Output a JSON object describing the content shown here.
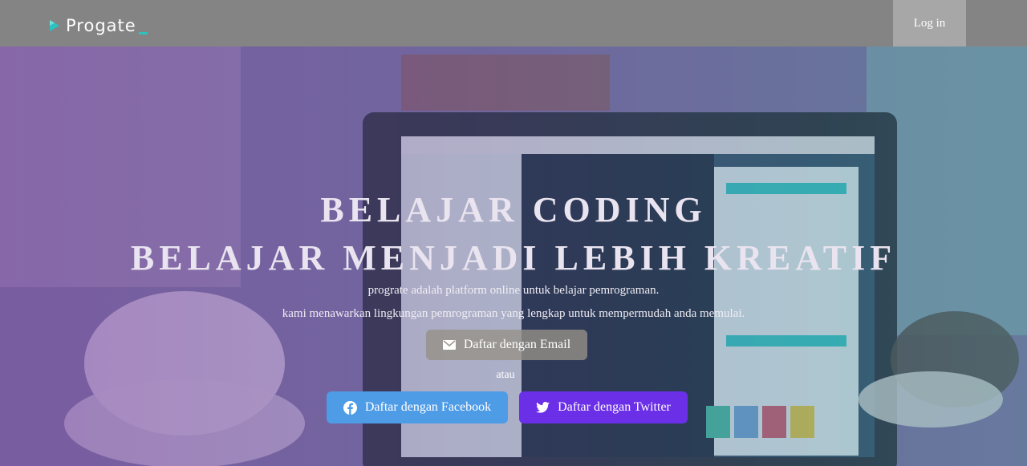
{
  "header": {
    "logo_text": "Progate",
    "login_label": "Log in"
  },
  "hero": {
    "title_line1": "BELAJAR CODING",
    "title_line2": "BELAJAR MENJADI LEBIH KREATIF",
    "desc_line1": "prograte adalah platform online untuk belajar pemrograman.",
    "desc_line2": "kami menawarkan lingkungan pemrograman yang lengkap untuk mempermudah anda memulai.",
    "email_button": "Daftar dengan Email",
    "or_text": "atau",
    "facebook_button": "Daftar dengan Facebook",
    "twitter_button": "Daftar dengan Twitter"
  },
  "colors": {
    "header_bg": "#848484",
    "login_bg": "#a7a7a7",
    "facebook": "#4e9be6",
    "twitter": "#6a2fe6",
    "logo_accent": "#2bc2c0"
  },
  "icons": [
    "logo-play-icon",
    "envelope-icon",
    "facebook-icon",
    "twitter-icon"
  ]
}
